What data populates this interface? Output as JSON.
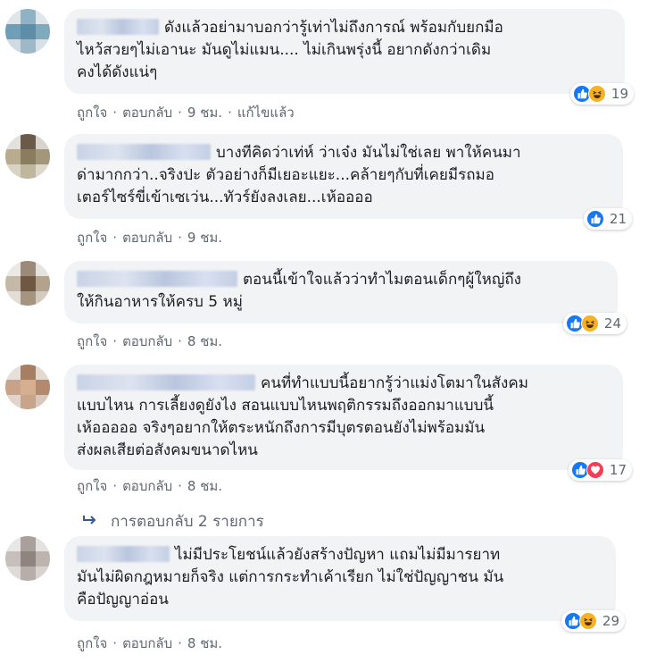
{
  "comments": [
    {
      "lines": [
        "ดังแล้วอย่ามาบอกว่ารู้เท่าไม่ถึงการณ์ พร้อมกับยกมือ",
        "ไหว้สวยๆไม่เอานะ มันดูไม่แมน.... ไม่เกินพรุ่งนี้ อยากดังกว่าเดิม",
        "คงได้ดังแน่ๆ"
      ],
      "reactions": [
        "like",
        "haha"
      ],
      "count": "19",
      "like": "ถูกใจ",
      "reply": "ตอบกลับ",
      "time": "9 ชม.",
      "edited": "แก้ไขแล้ว"
    },
    {
      "lines": [
        "บางทีคิดว่าเท่ห์ ว่าเจ๋ง มันไม่ใช่เลย พาให้คนมา",
        "ด่ามากกว่า..จริงปะ ตัวอย่างก็มีเยอะแยะ...คล้ายๆกับที่เคยมีรถมอ",
        "เตอร์ไซร์ขี่เข้าเซเว่น...ทัวร์ยังลงเลย...เห้ออออ"
      ],
      "reactions": [
        "like"
      ],
      "count": "21",
      "like": "ถูกใจ",
      "reply": "ตอบกลับ",
      "time": "9 ชม."
    },
    {
      "lines": [
        "ตอนนี้เข้าใจแล้วว่าทำไมตอนเด็กๆผู้ใหญ่ถึง",
        "ให้กินอาหารให้ครบ 5 หมู่"
      ],
      "reactions": [
        "like",
        "haha"
      ],
      "count": "24",
      "like": "ถูกใจ",
      "reply": "ตอบกลับ",
      "time": "8 ชม."
    },
    {
      "lines": [
        "คนที่ทำแบบนี้อยากรู้ว่าแม่งโตมาในสังคม",
        "แบบไหน การเลี้ยงดูยังไง สอนแบบไหนพฤติกรรมถึงออกมาแบบนี้",
        "เห้อออออ จริงๆอยากให้ตระหนักถึงการมีบุตรตอนยังไม่พร้อมมัน",
        "ส่งผลเสียต่อสังคมขนาดไหน"
      ],
      "reactions": [
        "like",
        "love"
      ],
      "count": "17",
      "like": "ถูกใจ",
      "reply": "ตอบกลับ",
      "time": "8 ชม."
    },
    {
      "lines": [
        "ไม่มีประโยชน์แล้วยังสร้างปัญหา แถมไม่มีมารยาท",
        "มันไม่ผิดกฎหมายก็จริง แต่การกระทำเค้าเรียก ไม่ใช่ปัญญาชน มัน",
        "คือปัญญาอ่อน"
      ],
      "reactions": [
        "like",
        "haha"
      ],
      "count": "29",
      "like": "ถูกใจ",
      "reply": "ตอบกลับ",
      "time": "8 ชม."
    }
  ],
  "replies_link": "การตอบกลับ 2 รายการ",
  "separator": "·",
  "icons": {
    "replies": "reply-arrow-icon",
    "like": "like-icon",
    "haha": "haha-icon",
    "love": "love-icon"
  },
  "colors": {
    "like": "#1877f2",
    "haha": "#f7b125",
    "love": "#f33e58",
    "meta": "#606770",
    "bubble": "#f2f3f5"
  }
}
